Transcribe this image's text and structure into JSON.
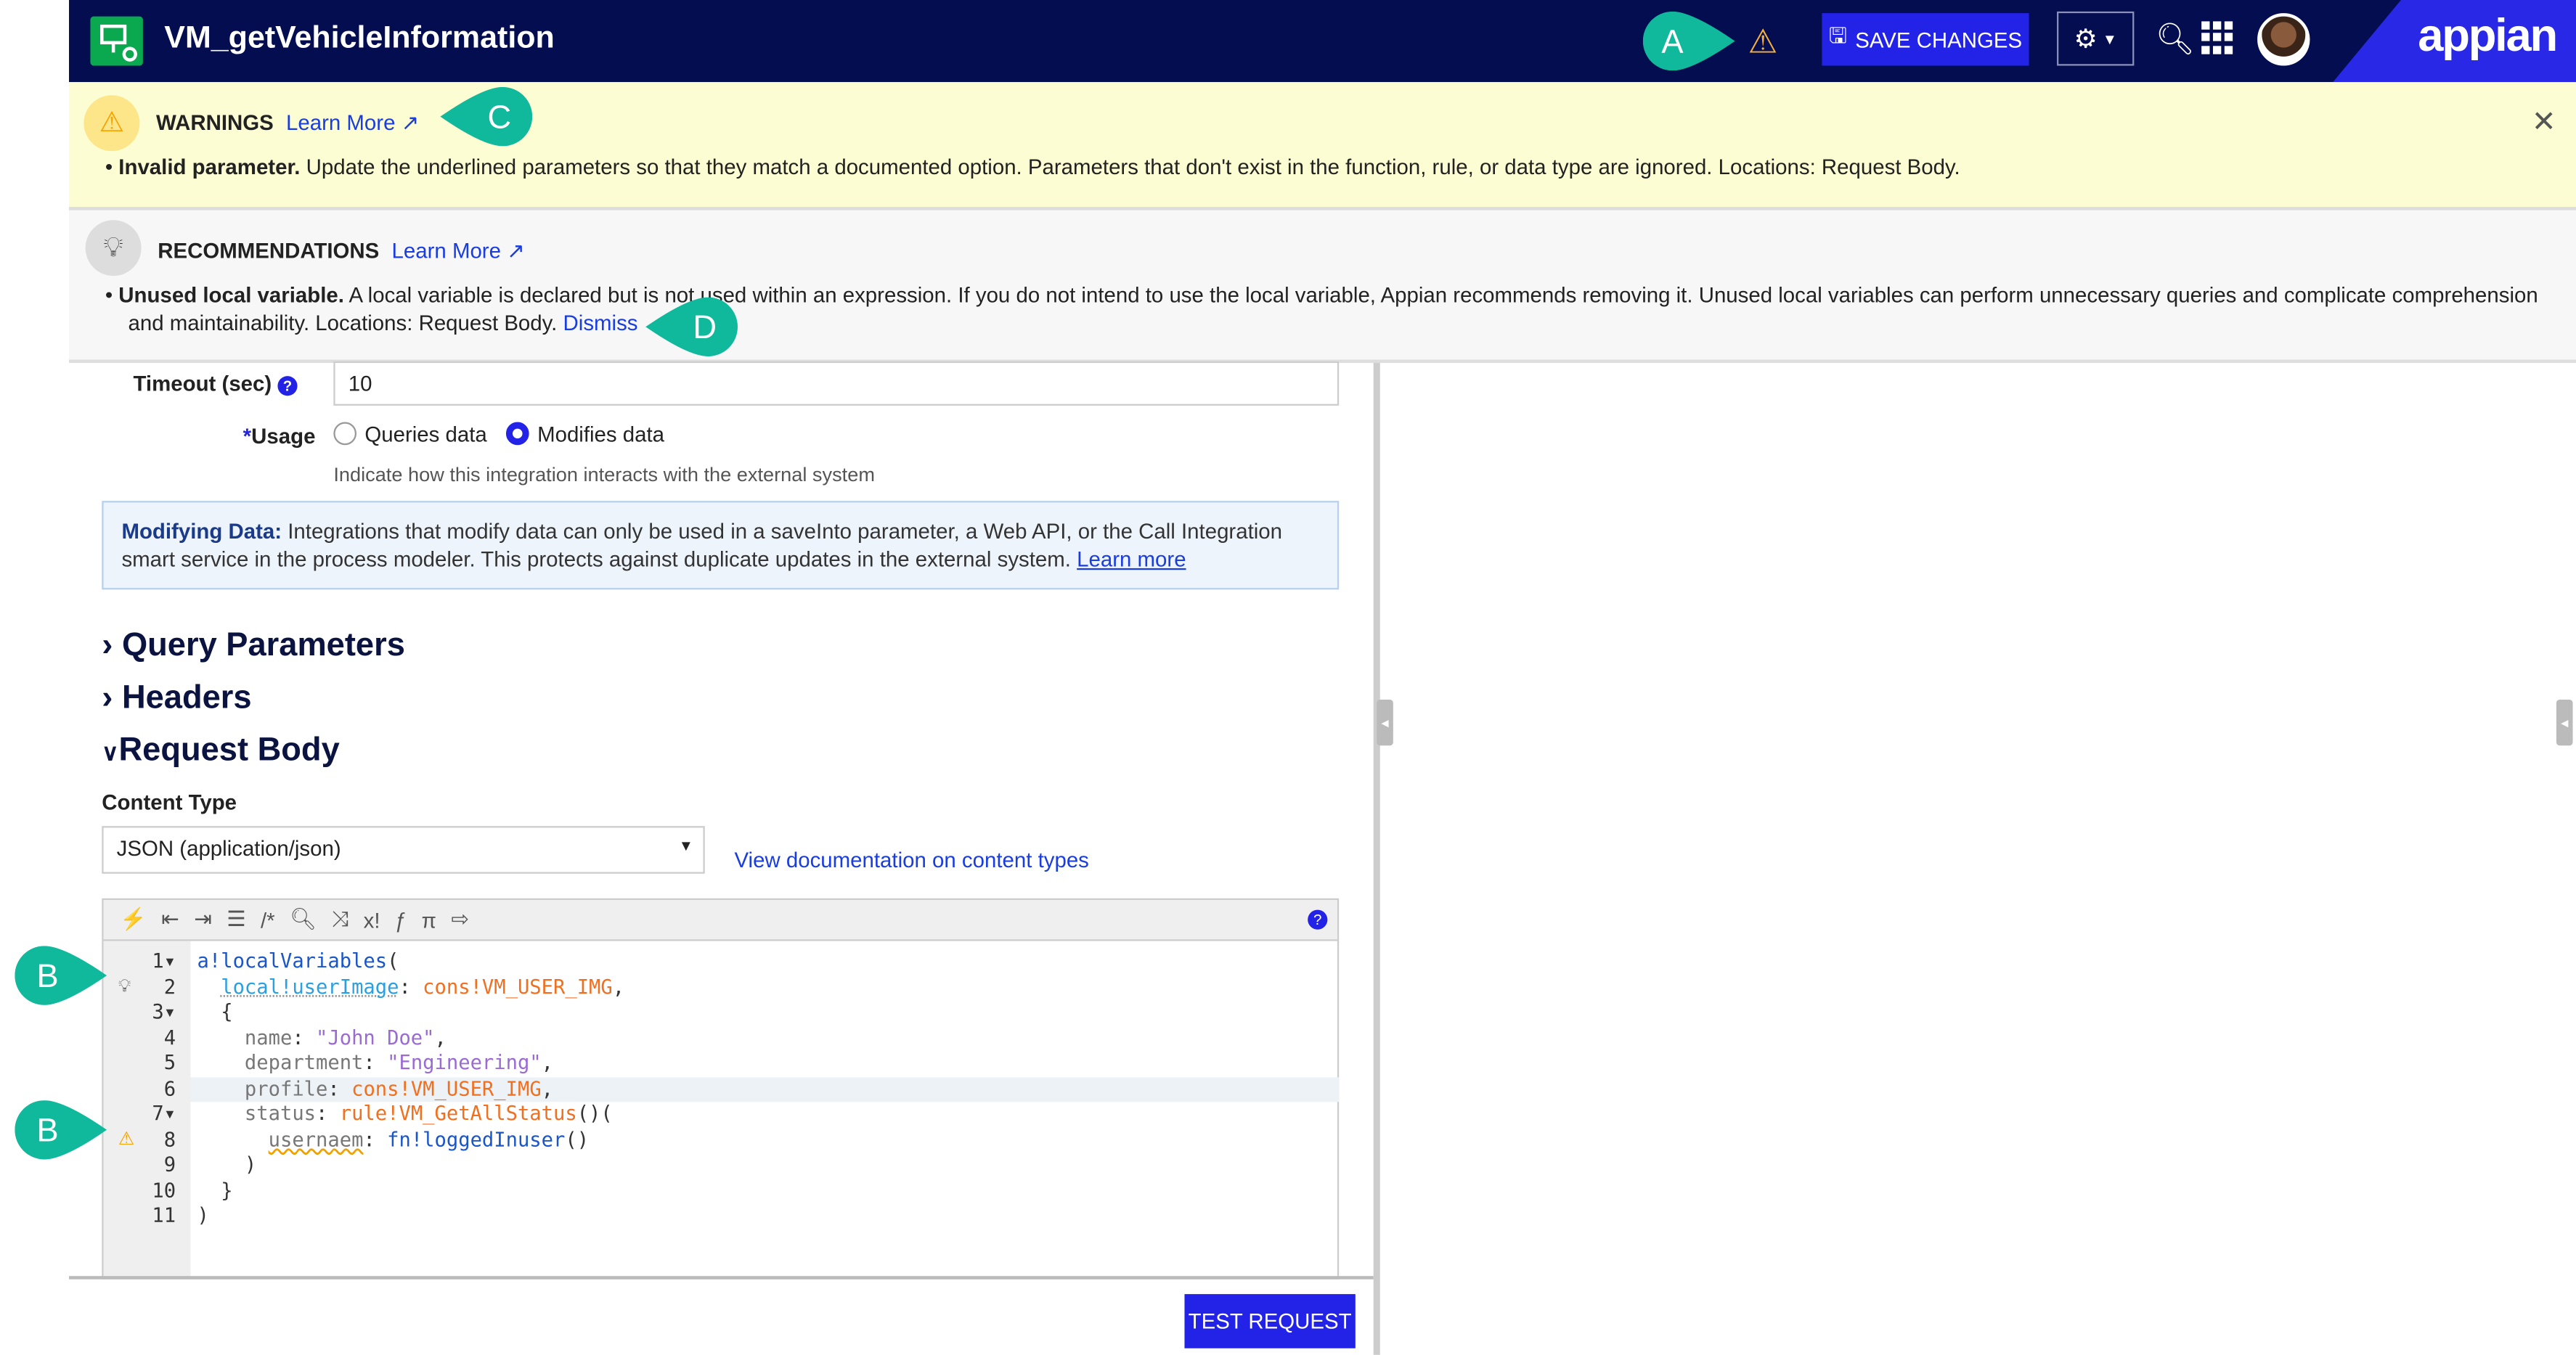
{
  "header": {
    "title": "VM_getVehicleInformation",
    "save_label": "SAVE CHANGES",
    "brand": "appian"
  },
  "warnings": {
    "title": "WARNINGS",
    "learn_more": "Learn More",
    "items": [
      {
        "bold": "Invalid parameter.",
        "text": " Update the underlined parameters so that they match a documented option. Parameters that don't exist in the function, rule, or data type are ignored. Locations: Request Body."
      }
    ]
  },
  "recommendations": {
    "title": "RECOMMENDATIONS",
    "learn_more": "Learn More",
    "items": [
      {
        "bold": "Unused local variable.",
        "text": " A local variable is declared but is not used within an expression. If you do not intend to use the local variable, Appian recommends removing it. Unused local variables can perform unnecessary queries and complicate comprehension and maintainability. Locations: Request Body. ",
        "dismiss": "Dismiss"
      }
    ]
  },
  "form": {
    "timeout_label": "Timeout (sec)",
    "timeout_value": "10",
    "usage_label": "Usage",
    "usage_required": "*",
    "usage_options": [
      "Queries data",
      "Modifies data"
    ],
    "usage_selected": "Modifies data",
    "usage_help": "Indicate how this integration interacts with the external system",
    "info_bold": "Modifying Data:",
    "info_text": " Integrations that modify data can only be used in a saveInto parameter, a Web API, or the Call Integration smart service in the process modeler. This protects against duplicate updates in the external system. ",
    "info_link": "Learn more",
    "sections": [
      "Query Parameters",
      "Headers",
      "Request Body"
    ],
    "content_type_label": "Content Type",
    "content_type_value": "JSON (application/json)",
    "content_type_doc": "View documentation on content types",
    "test_label": "TEST REQUEST"
  },
  "editor": {
    "toolbar_icons": [
      "magic-wand",
      "outdent",
      "indent",
      "list",
      "comment",
      "search",
      "shuffle",
      "x-factorial",
      "function",
      "pi",
      "export"
    ],
    "lines": [
      [
        [
          "a!localVariables",
          "fn"
        ],
        [
          "(",
          "p"
        ]
      ],
      [
        [
          "  ",
          "p"
        ],
        [
          "local!userImage",
          "loc"
        ],
        [
          ": ",
          "p"
        ],
        [
          "cons!VM_USER_IMG",
          "cons"
        ],
        [
          ",",
          "p"
        ]
      ],
      [
        [
          "  {",
          "p"
        ]
      ],
      [
        [
          "    name",
          "key"
        ],
        [
          ": ",
          "p"
        ],
        [
          "\"John Doe\"",
          "str"
        ],
        [
          ",",
          "p"
        ]
      ],
      [
        [
          "    department",
          "key"
        ],
        [
          ": ",
          "p"
        ],
        [
          "\"Engineering\"",
          "str"
        ],
        [
          ",",
          "p"
        ]
      ],
      [
        [
          "    profile",
          "key"
        ],
        [
          ": ",
          "p"
        ],
        [
          "cons!VM_USER_IMG",
          "cons"
        ],
        [
          ",",
          "p"
        ]
      ],
      [
        [
          "    status",
          "key"
        ],
        [
          ": ",
          "p"
        ],
        [
          "rule!VM_GetAllStatus",
          "cons"
        ],
        [
          "()(",
          "p"
        ]
      ],
      [
        [
          "      ",
          "p"
        ],
        [
          "usernaem",
          "bad"
        ],
        [
          ": ",
          "p"
        ],
        [
          "fn!loggedInuser",
          "fn"
        ],
        [
          "()",
          "p"
        ]
      ],
      [
        [
          "    )",
          "p"
        ]
      ],
      [
        [
          "  }",
          "p"
        ]
      ],
      [
        [
          ")",
          "p"
        ]
      ]
    ],
    "fold_lines": [
      1,
      3,
      7
    ],
    "hint_line": 2,
    "warn_line": 8,
    "active_line": 6
  },
  "callouts": {
    "a": "A",
    "b": "B",
    "c": "C",
    "d": "D"
  },
  "colors": {
    "header": "#030d4f",
    "primary": "#2323e8",
    "callout": "#10b89c",
    "warning_bg": "#fdfdd3"
  }
}
